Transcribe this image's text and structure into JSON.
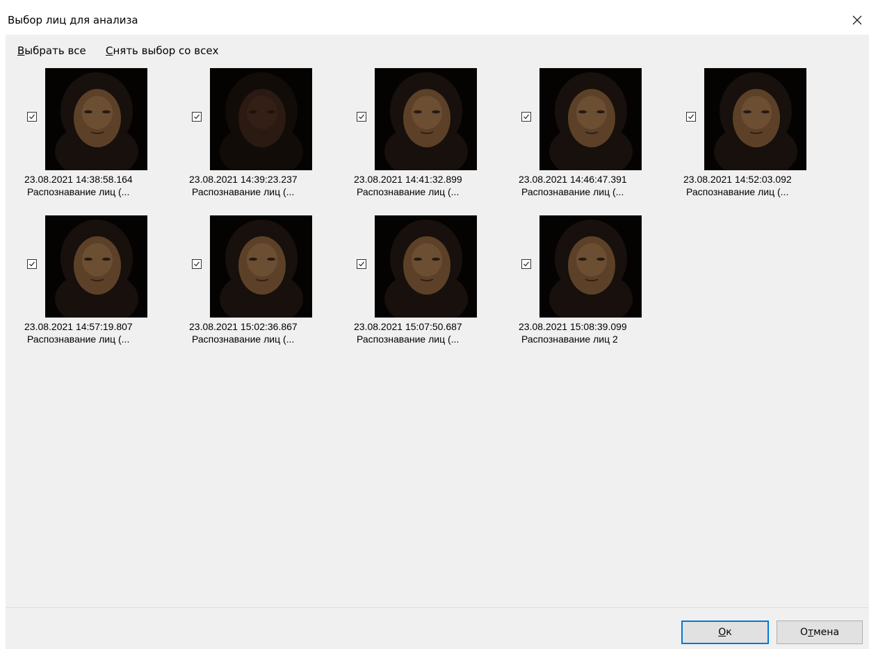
{
  "window": {
    "title": "Выбор лиц для анализа"
  },
  "toolbar": {
    "select_all_u": "В",
    "select_all_rest": "ыбрать все",
    "deselect_all_u": "С",
    "deselect_all_rest": "нять выбор со всех"
  },
  "faces": [
    {
      "timestamp": "23.08.2021 14:38:58.164",
      "caption": "Распознавание лиц (...",
      "checked": true,
      "brightness": "normal"
    },
    {
      "timestamp": "23.08.2021 14:39:23.237",
      "caption": "Распознавание лиц (...",
      "checked": true,
      "brightness": "dark"
    },
    {
      "timestamp": "23.08.2021 14:41:32.899",
      "caption": "Распознавание лиц (...",
      "checked": true,
      "brightness": "normal"
    },
    {
      "timestamp": "23.08.2021 14:46:47.391",
      "caption": "Распознавание лиц (...",
      "checked": true,
      "brightness": "normal"
    },
    {
      "timestamp": "23.08.2021 14:52:03.092",
      "caption": "Распознавание лиц (...",
      "checked": true,
      "brightness": "normal"
    },
    {
      "timestamp": "23.08.2021 14:57:19.807",
      "caption": "Распознавание лиц (...",
      "checked": true,
      "brightness": "normal"
    },
    {
      "timestamp": "23.08.2021 15:02:36.867",
      "caption": "Распознавание лиц (...",
      "checked": true,
      "brightness": "normal"
    },
    {
      "timestamp": "23.08.2021 15:07:50.687",
      "caption": "Распознавание лиц (...",
      "checked": true,
      "brightness": "normal"
    },
    {
      "timestamp": "23.08.2021 15:08:39.099",
      "caption": "Распознавание лиц 2",
      "checked": true,
      "brightness": "normal"
    }
  ],
  "buttons": {
    "ok_u": "О",
    "ok_rest": "к",
    "cancel_pre": "О",
    "cancel_u": "т",
    "cancel_rest": "мена"
  },
  "colors": {
    "accent": "#0078d7",
    "background": "#f0f0f0",
    "thumb_bg": "#050302"
  },
  "icons": {
    "close": "close-icon",
    "checkbox": "checkmark-icon"
  }
}
